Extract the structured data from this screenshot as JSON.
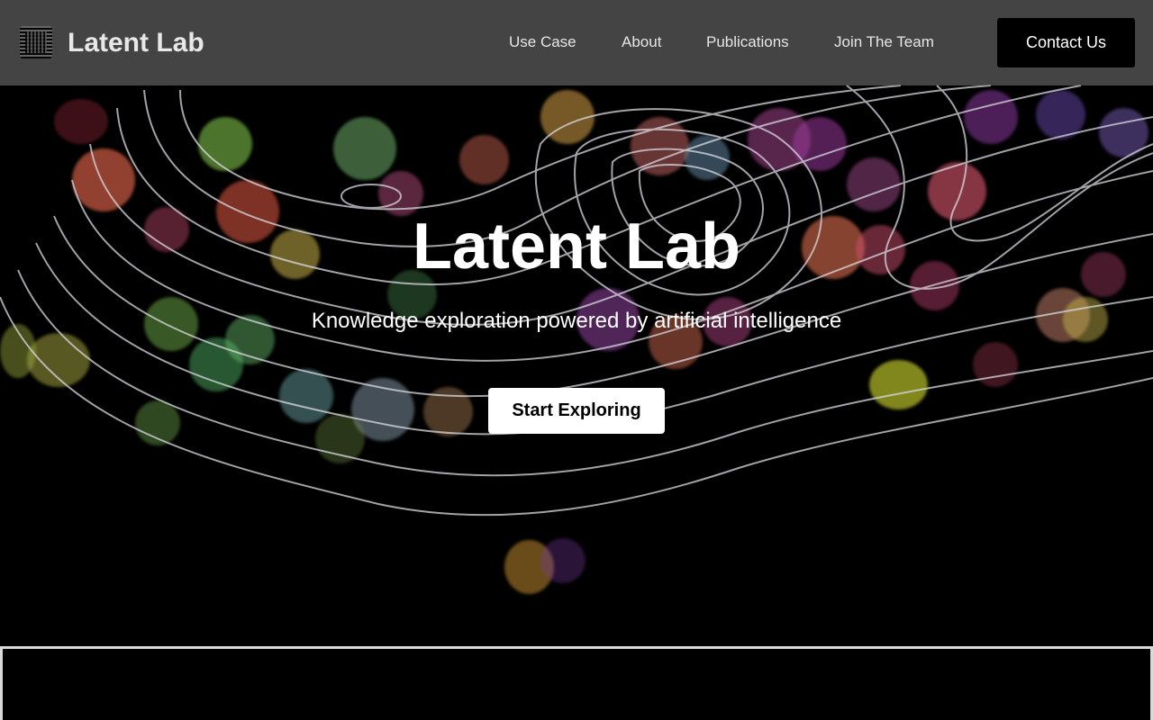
{
  "header": {
    "brand": "Latent Lab",
    "logo_icon": "dotted-square-logo-icon",
    "nav": [
      {
        "label": "Use Case"
      },
      {
        "label": "About"
      },
      {
        "label": "Publications"
      },
      {
        "label": "Join The Team"
      }
    ],
    "contact_label": "Contact Us"
  },
  "hero": {
    "title": "Latent Lab",
    "subtitle": "Knowledge exploration powered by artificial intelligence",
    "cta_label": "Start Exploring"
  },
  "colors": {
    "background": "#000000",
    "navbar": "#6e6e6e",
    "cta_bg": "#ffffff",
    "contact_bg": "#000000",
    "contour_line": "#d8d8e0"
  }
}
